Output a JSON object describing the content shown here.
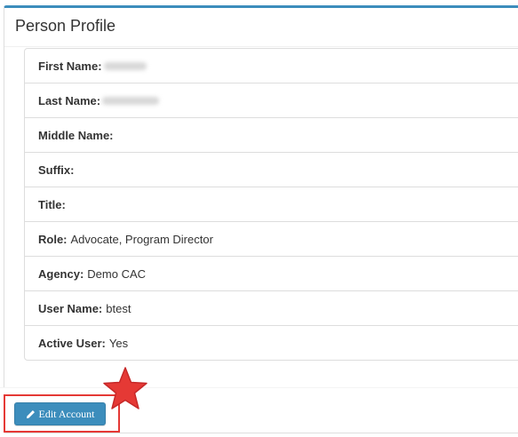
{
  "panel": {
    "title": "Person Profile"
  },
  "profile": {
    "fields": [
      {
        "label": "First Name:",
        "value": ""
      },
      {
        "label": "Last Name:",
        "value": ""
      },
      {
        "label": "Middle Name:",
        "value": ""
      },
      {
        "label": "Suffix:",
        "value": ""
      },
      {
        "label": "Title:",
        "value": ""
      },
      {
        "label": "Role:",
        "value": "Advocate, Program Director"
      },
      {
        "label": "Agency:",
        "value": "Demo CAC"
      },
      {
        "label": "User Name:",
        "value": "btest"
      },
      {
        "label": "Active User:",
        "value": "Yes"
      }
    ]
  },
  "footer": {
    "edit_button_label": "Edit Account",
    "edit_button_icon": "pencil-icon"
  },
  "annotation": {
    "star_color": "#e53935",
    "highlight_color": "#e53935"
  },
  "colors": {
    "accent": "#3c8dbc",
    "border": "#dddddd"
  }
}
